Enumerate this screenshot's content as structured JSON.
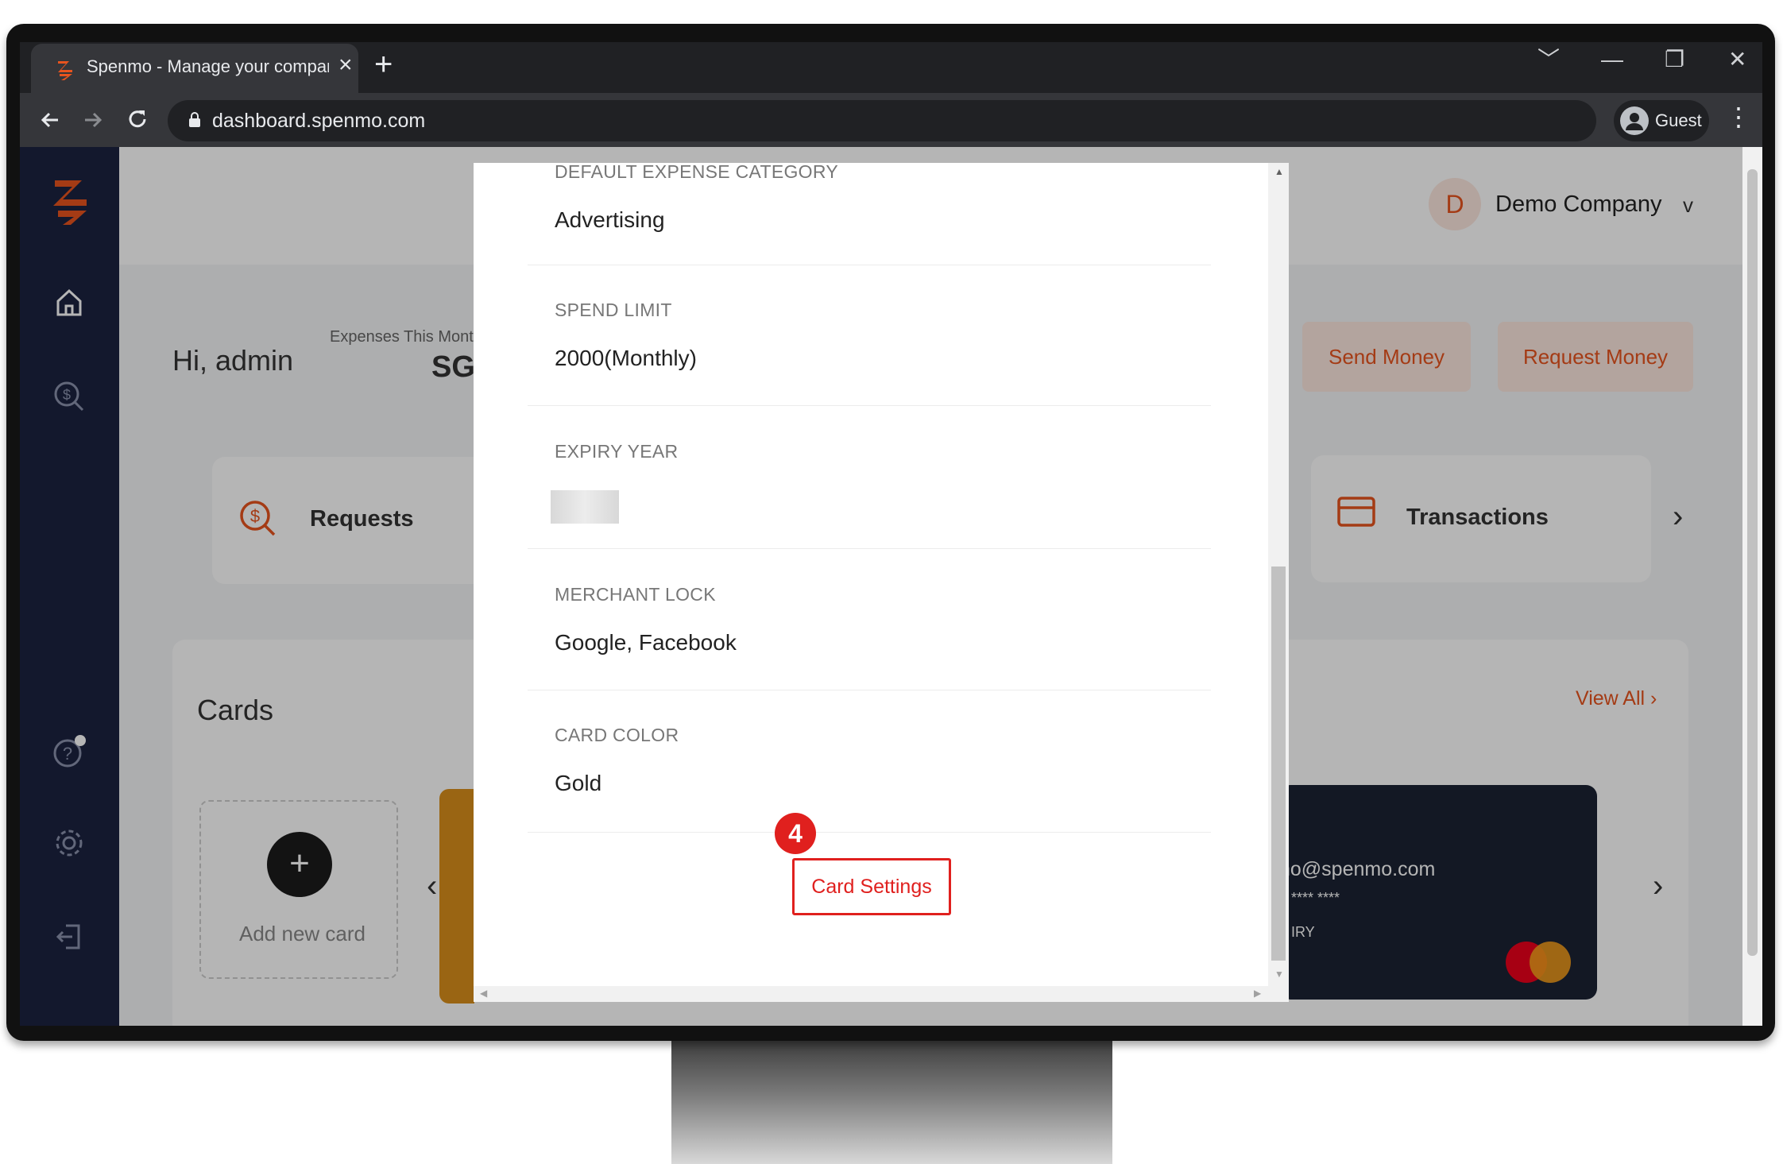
{
  "browser": {
    "tab_title": "Spenmo - Manage your company",
    "tab_close": "×",
    "new_tab": "+",
    "url": "dashboard.spenmo.com",
    "profile_label": "Guest",
    "window_controls": [
      "﹀",
      "—",
      "❐",
      "✕"
    ]
  },
  "header": {
    "company_initial": "D",
    "company_name": "Demo Company",
    "dropdown": "v"
  },
  "greeting": "Hi, admin",
  "expenses": {
    "label": "Expenses This Month",
    "value": "SG"
  },
  "actions": {
    "send_money": "Send Money",
    "request_money": "Request Money"
  },
  "tiles": {
    "requests": "Requests",
    "transactions": "Transactions"
  },
  "cards_section": {
    "title": "Cards",
    "view_all": "View All ›",
    "add_new": "Add new card",
    "dark_card_email": "no@spenmo.com",
    "dark_card_number": "**** ****",
    "dark_card_expiry_label": "IRY"
  },
  "modal": {
    "fields": [
      {
        "label": "DEFAULT EXPENSE CATEGORY",
        "value": "Advertising"
      },
      {
        "label": "SPEND LIMIT",
        "value": "2000(Monthly)"
      },
      {
        "label": "EXPIRY YEAR",
        "value": ""
      },
      {
        "label": "MERCHANT LOCK",
        "value": "Google, Facebook"
      },
      {
        "label": "CARD COLOR",
        "value": "Gold"
      }
    ],
    "button": "Card Settings",
    "step_number": "4"
  },
  "colors": {
    "brand_orange": "#e8541e",
    "sidebar": "#1c2340",
    "highlight_red": "#e0201e"
  }
}
